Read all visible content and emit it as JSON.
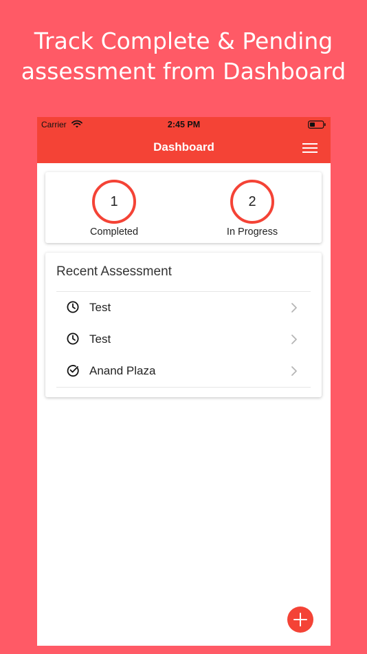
{
  "headline": {
    "line1": "Track Complete & Pending",
    "line2": "assessment from Dashboard"
  },
  "status_bar": {
    "carrier": "Carrier",
    "time": "2:45 PM"
  },
  "nav": {
    "title": "Dashboard"
  },
  "stats": [
    {
      "value": "1",
      "label": "Completed"
    },
    {
      "value": "2",
      "label": "In Progress"
    }
  ],
  "recent": {
    "title": "Recent Assessment",
    "items": [
      {
        "label": "Test",
        "icon": "clock-icon",
        "status": "pending"
      },
      {
        "label": "Test",
        "icon": "clock-icon",
        "status": "pending"
      },
      {
        "label": "Anand Plaza",
        "icon": "check-circle-icon",
        "status": "completed"
      }
    ]
  },
  "colors": {
    "background": "#FF5A66",
    "accent": "#F44336",
    "card": "#FFFFFF"
  }
}
